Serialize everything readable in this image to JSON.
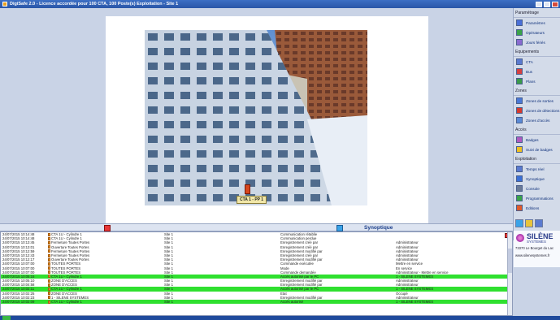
{
  "window": {
    "title": "DigiSafe 2.0 - Licence accordée pour 100 CTA, 100 Poste(s) Exploitation - Site 1"
  },
  "map": {
    "marker_label": "CTA 1 - PP 1"
  },
  "status": {
    "synoptique_label": "Synoptique"
  },
  "sidebar": {
    "sections": [
      {
        "title": "Paramétrage",
        "items": [
          {
            "label": "Paramètres",
            "icon": "settings-icon",
            "color": "#4a6fd8"
          }
        ]
      },
      {
        "title": "",
        "items": [
          {
            "label": "Opérateurs",
            "icon": "operator-icon",
            "color": "#3aa34a"
          },
          {
            "label": "Jours fériés",
            "icon": "calendar-icon",
            "color": "#8a6bd0"
          }
        ]
      },
      {
        "title": "Equipements",
        "items": [
          {
            "label": "CTA",
            "icon": "cta-icon",
            "color": "#5a7ad0"
          },
          {
            "label": "Bus",
            "icon": "bus-icon",
            "color": "#d64040"
          }
        ]
      },
      {
        "title": "",
        "items": [
          {
            "label": "Plans",
            "icon": "map-icon",
            "color": "#3a9a4a"
          }
        ]
      },
      {
        "title": "Zones",
        "items": [
          {
            "label": "Zones de sorties",
            "icon": "exit-zone-icon",
            "color": "#4a78d6"
          },
          {
            "label": "Zones de détections",
            "icon": "detection-zone-icon",
            "color": "#d63a2e"
          },
          {
            "label": "Zones d'accès",
            "icon": "access-zone-icon",
            "color": "#5a8ad6"
          }
        ]
      },
      {
        "title": "Accès",
        "items": [
          {
            "label": "Badges",
            "icon": "badge-icon",
            "color": "#b05ac0"
          },
          {
            "label": "Suivi de badges",
            "icon": "badge-tracking-icon",
            "color": "#f0c020"
          }
        ]
      },
      {
        "title": "Exploitation",
        "items": [
          {
            "label": "Temps réel",
            "icon": "realtime-icon",
            "color": "#5a7ad0"
          },
          {
            "label": "Synoptique",
            "icon": "synoptic-icon",
            "color": "#3a6fd6"
          },
          {
            "label": "Console",
            "icon": "console-icon",
            "color": "#6a7a96"
          }
        ]
      },
      {
        "title": "",
        "items": [
          {
            "label": "Programmations",
            "icon": "programming-icon",
            "color": "#3aa34a"
          },
          {
            "label": "Editions",
            "icon": "editions-icon",
            "color": "#e05a2a"
          }
        ]
      }
    ],
    "brand_name": "SILÈNE",
    "brand_sub": "SYSTEMES",
    "address": "73370 Le Bourget du Lac",
    "website": "www.silenesystemes.fr"
  },
  "log": {
    "rows": [
      {
        "date": "24/07/2015 10:14:48",
        "elem": "CTA 1U - Cylindre 1",
        "site": "Site 1",
        "event": "Communication rétablie",
        "user": "",
        "alarm": false
      },
      {
        "date": "24/07/2015 10:14:48",
        "elem": "CTA 1U - Cylindre 1",
        "site": "Site 1",
        "event": "Communication perdue",
        "user": "",
        "alarm": false
      },
      {
        "date": "24/07/2015 10:13:45",
        "elem": "Fermeture Toutes Portes",
        "site": "Site 1",
        "event": "Enregistrement créé par",
        "user": "Administrateur",
        "alarm": false
      },
      {
        "date": "24/07/2015 10:13:01",
        "elem": "Ouverture Toutes Portes",
        "site": "Site 1",
        "event": "Enregistrement créé par",
        "user": "Administrateur",
        "alarm": false
      },
      {
        "date": "24/07/2015 10:12:59",
        "elem": "Fermeture Toutes Portes",
        "site": "Site 1",
        "event": "Enregistrement modifié par",
        "user": "Administrateur",
        "alarm": false
      },
      {
        "date": "24/07/2015 10:12:43",
        "elem": "Fermeture Toutes Portes",
        "site": "Site 1",
        "event": "Enregistrement créé par",
        "user": "Administrateur",
        "alarm": false
      },
      {
        "date": "24/07/2015 10:12:17",
        "elem": "Ouverture Toutes Portes",
        "site": "Site 1",
        "event": "Enregistrement modifié par",
        "user": "Administrateur",
        "alarm": false
      },
      {
        "date": "24/07/2015 10:07:00",
        "elem": "TOUTES PORTES",
        "site": "Site 1",
        "event": "Commande exécutée",
        "user": "Mettre en service",
        "alarm": false
      },
      {
        "date": "24/07/2015 10:07:00",
        "elem": "TOUTES PORTES",
        "site": "Site 1",
        "event": "Mode",
        "user": "En service",
        "alarm": false
      },
      {
        "date": "24/07/2015 10:07:00",
        "elem": "TOUTES PORTES",
        "site": "Site 1",
        "event": "Commande demandée",
        "user": "Administrateur - Mettre en service",
        "alarm": false
      },
      {
        "date": "24/07/2015 10:05:15",
        "elem": "CTA 1U - Cylindre 1",
        "site": "Site 1",
        "event": "Accès autorisé par le PC",
        "user": "1 - SILENE SYSTEMES",
        "alarm": true
      },
      {
        "date": "24/07/2015 10:05:10",
        "elem": "ZONE D'ACCES",
        "site": "Site 1",
        "event": "Enregistrement modifié par",
        "user": "Administrateur",
        "alarm": false
      },
      {
        "date": "24/07/2015 10:04:58",
        "elem": "ZONE D'ACCES",
        "site": "Site 1",
        "event": "Enregistrement modifié par",
        "user": "Administrateur",
        "alarm": false
      },
      {
        "date": "24/07/2015 10:02:11",
        "elem": "CTA 1U - Cylindre 1",
        "site": "Site 1",
        "event": "Accès autorisé par le PC",
        "user": "1 - SILENE SYSTEMES",
        "alarm": true
      },
      {
        "date": "24/07/2015 10:02:25",
        "elem": "ZONE D'ACCES",
        "site": "Site 1",
        "event": "Etat",
        "user": "Occupé",
        "alarm": false
      },
      {
        "date": "24/07/2015 10:02:23",
        "elem": "1 - SILENE SYSTEMES",
        "site": "Site 1",
        "event": "Enregistrement modifié par",
        "user": "Administrateur",
        "alarm": false
      },
      {
        "date": "24/07/2015 10:02:09",
        "elem": "CTA 1U - Cylindre 1",
        "site": "Site 1",
        "event": "Accès autorisé",
        "user": "1 - SILENE SYSTEMES",
        "alarm": true
      }
    ]
  }
}
